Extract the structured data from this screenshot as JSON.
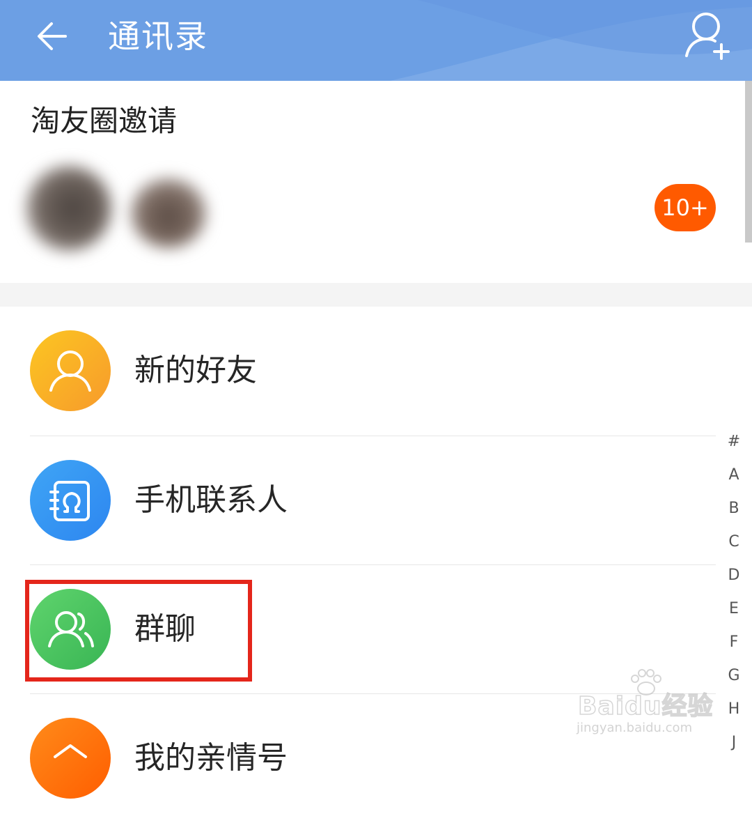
{
  "header": {
    "title": "通讯录",
    "color": "#6c9fe4"
  },
  "invite": {
    "title": "淘友圈邀请",
    "badge": "10+",
    "badge_color": "#ff5a00"
  },
  "menu": [
    {
      "label": "新的好友",
      "icon": "new-friend-person-icon",
      "color": "#f7a92a"
    },
    {
      "label": "手机联系人",
      "icon": "phone-contacts-book-icon",
      "color": "#3196f3"
    },
    {
      "label": "群聊",
      "icon": "group-chat-people-icon",
      "color": "#47c25e",
      "highlighted": true
    },
    {
      "label": "我的亲情号",
      "icon": "family-account-icon",
      "color": "#ff6f0a"
    }
  ],
  "index": [
    "#",
    "A",
    "B",
    "C",
    "D",
    "E",
    "F",
    "G",
    "H",
    "J"
  ],
  "watermark": {
    "brand": "Baidu经验",
    "url": "jingyan.baidu.com"
  },
  "highlight_color": "#e4261b"
}
